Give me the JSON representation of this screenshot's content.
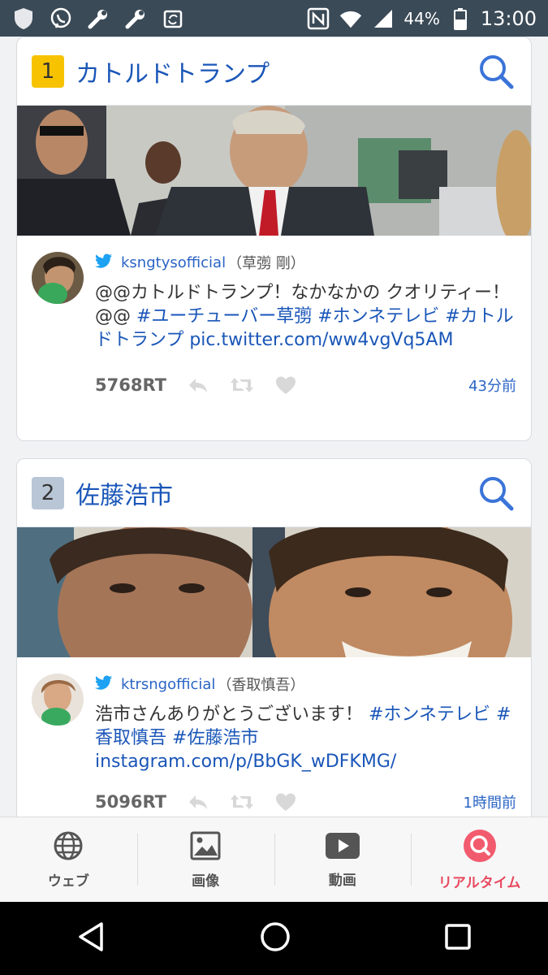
{
  "status_bar": {
    "battery": "44%",
    "time": "13:00",
    "icons_left": [
      "shield-icon",
      "viber-icon",
      "wrench-icon",
      "wrench-icon",
      "sync-icon"
    ],
    "icons_right": [
      "nfc-icon",
      "wifi-icon",
      "signal-icon",
      "battery-icon"
    ]
  },
  "cards": [
    {
      "rank": "1",
      "title": "カトルドトランプ",
      "tweet": {
        "handle": "ksngtysofficial",
        "display_name": "（草彅 剛）",
        "text_parts": [
          "@@カトルドトランプ！なかなかの クオリティー！@@ ",
          "#ユーチューバー草彅",
          " ",
          "#ホンネテレビ",
          " ",
          "#カトルドトランプ",
          " ",
          "pic.twitter.com/ww4vgVq5AM"
        ],
        "retweets": "5768RT",
        "age": "43分前"
      }
    },
    {
      "rank": "2",
      "title": "佐藤浩市",
      "tweet": {
        "handle": "ktrsngofficial",
        "display_name": "（香取慎吾）",
        "text_parts": [
          "浩市さんありがとうございます！ ",
          "#ホンネテレビ",
          " ",
          "#香取慎吾",
          " ",
          "#佐藤浩市",
          " ",
          "instagram.com/p/BbGK_wDFKMG/"
        ],
        "retweets": "5096RT",
        "age": "1時間前"
      }
    }
  ],
  "tabs": [
    {
      "label": "ウェブ",
      "icon": "globe-icon",
      "active": false
    },
    {
      "label": "画像",
      "icon": "image-icon",
      "active": false
    },
    {
      "label": "動画",
      "icon": "video-icon",
      "active": false
    },
    {
      "label": "リアルタイム",
      "icon": "realtime-search-icon",
      "active": true
    }
  ],
  "colors": {
    "accent": "#1a56b8",
    "active_tab": "#e84a5f",
    "rank1": "#f7c300",
    "rank2": "#b8c6d6",
    "status_bar": "#3b4a57"
  }
}
